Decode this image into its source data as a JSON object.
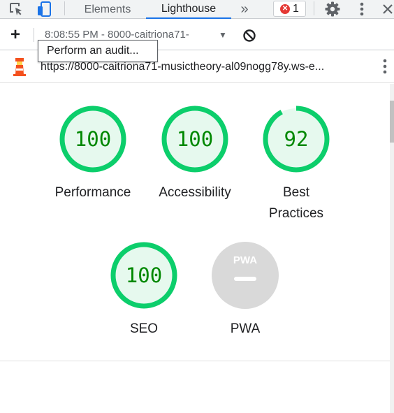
{
  "tabbar": {
    "tabs": [
      {
        "label": "Elements",
        "active": false
      },
      {
        "label": "Lighthouse",
        "active": true
      }
    ],
    "more_tabs_icon": "»",
    "error_count": "1",
    "icons": [
      "inspect-element-icon",
      "device-toolbar-icon",
      "chevrons-right-icon",
      "error-icon",
      "gear-icon",
      "kebab-menu-icon",
      "close-icon"
    ]
  },
  "toolbar": {
    "add_icon": "+",
    "report_selector": "8:08:55 PM - 8000-caitriona71-",
    "dropdown_icon": "▼",
    "clear_icon": "block-icon",
    "tooltip": "Perform an audit..."
  },
  "urlbar": {
    "url": "https://8000-caitriona71-musictheory-al09nogg78y.ws-e..."
  },
  "categories": [
    {
      "label": "Performance",
      "score": "100",
      "fraction": 1.0
    },
    {
      "label": "Accessibility",
      "score": "100",
      "fraction": 1.0
    },
    {
      "label": "Best Practices",
      "label_line1": "Best",
      "label_line2": "Practices",
      "score": "92",
      "fraction": 0.92
    },
    {
      "label": "SEO",
      "score": "100",
      "fraction": 1.0
    },
    {
      "label": "PWA",
      "score": "—",
      "badge_text": "PWA"
    }
  ],
  "colors": {
    "pass": "#0cce6b",
    "pass_text": "#008800",
    "pass_fill": "#e6f9ee",
    "pwa_gray": "#d9d9d9",
    "accent": "#1a73e8",
    "error": "#e53935"
  }
}
